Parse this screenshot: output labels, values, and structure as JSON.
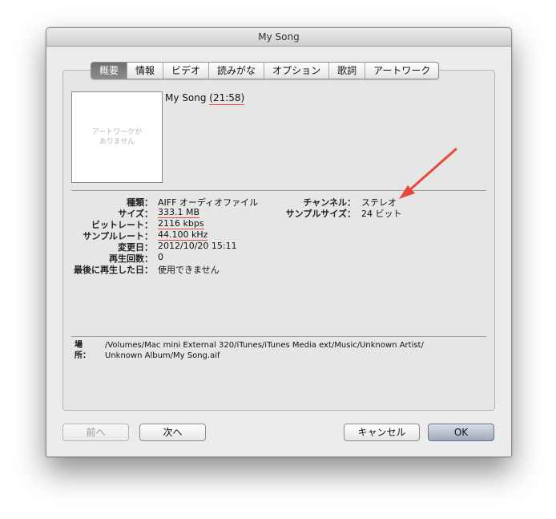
{
  "window": {
    "title": "My Song"
  },
  "tabs": [
    {
      "label": "概要",
      "active": true
    },
    {
      "label": "情報"
    },
    {
      "label": "ビデオ"
    },
    {
      "label": "読みがな"
    },
    {
      "label": "オプション"
    },
    {
      "label": "歌詞"
    },
    {
      "label": "アートワーク"
    }
  ],
  "artwork": {
    "placeholder_line1": "アートワークが",
    "placeholder_line2": "ありません"
  },
  "song": {
    "name": "My Song",
    "duration": "(21:58)"
  },
  "info_left": [
    {
      "label": "種類：",
      "value": "AIFF オーディオファイル"
    },
    {
      "label": "サイズ：",
      "value": "333.1 MB"
    },
    {
      "label": "ビットレート：",
      "value": "2116 kbps"
    },
    {
      "label": "サンプルレート：",
      "value": "44.100 kHz"
    },
    {
      "label": "変更日：",
      "value": "2012/10/20 15:11"
    },
    {
      "label": "再生回数：",
      "value": "0"
    },
    {
      "label": "最後に再生した日：",
      "value": "使用できません"
    }
  ],
  "info_right": [
    {
      "label": "チャンネル：",
      "value": "ステレオ"
    },
    {
      "label": "サンプルサイズ：",
      "value": "24 ビット"
    }
  ],
  "location": {
    "label": "場所：",
    "line1": "/Volumes/Mac mini External 320/iTunes/iTunes Media ext/Music/Unknown Artist/",
    "line2": "Unknown Album/My Song.aif"
  },
  "buttons": {
    "prev": "前へ",
    "next": "次へ",
    "cancel": "キャンセル",
    "ok": "OK"
  },
  "colors": {
    "annotation": "#e8473b",
    "default_button": "#a9b3c6"
  }
}
